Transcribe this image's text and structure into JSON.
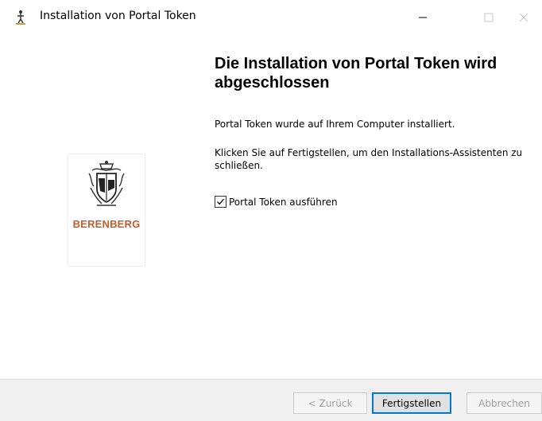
{
  "window": {
    "title": "Installation von Portal Token",
    "app_icon": "installer-figure-icon",
    "controls": [
      "minimize-icon",
      "maximize-icon",
      "close-icon"
    ]
  },
  "sidebar": {
    "logo_text": "BERENBERG",
    "logo_icon": "berenberg-crest-icon",
    "brand_color": "#c85b2c"
  },
  "main": {
    "heading": "Die Installation von Portal Token wird abgeschlossen",
    "paragraph1": "Portal Token wurde auf Ihrem Computer installiert.",
    "paragraph2": "Klicken Sie auf Fertigstellen, um den Installations-Assistenten zu schließen.",
    "checkbox_label": "Portal Token ausführen",
    "checkbox_checked": true
  },
  "footer": {
    "back_label": "< Zurück",
    "finish_label": "Fertigstellen",
    "cancel_label": "Abbrechen"
  },
  "colors": {
    "accent": "#0078d7",
    "footer_bg": "#f0f0f0"
  }
}
